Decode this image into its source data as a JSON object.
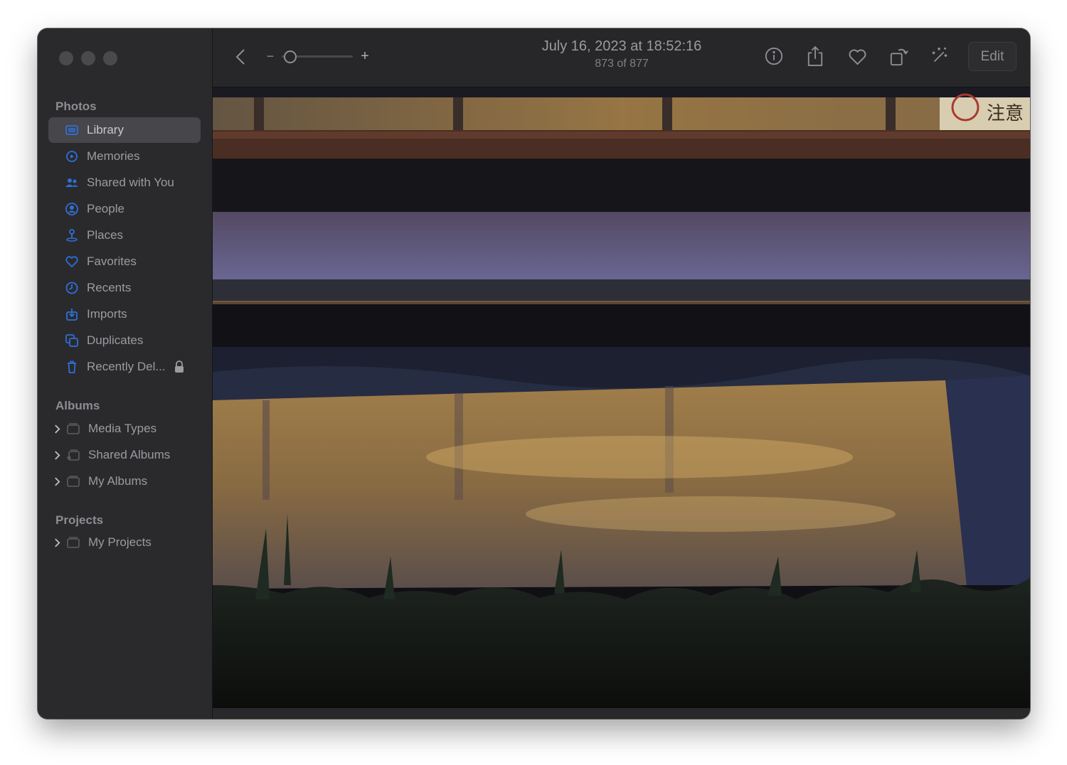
{
  "sidebar": {
    "sections": {
      "photos": "Photos",
      "albums": "Albums",
      "projects": "Projects"
    },
    "items": [
      {
        "label": "Library",
        "icon": "library-icon"
      },
      {
        "label": "Memories",
        "icon": "memories-icon"
      },
      {
        "label": "Shared with You",
        "icon": "shared-with-you-icon"
      },
      {
        "label": "People",
        "icon": "people-icon"
      },
      {
        "label": "Places",
        "icon": "places-icon"
      },
      {
        "label": "Favorites",
        "icon": "heart-icon"
      },
      {
        "label": "Recents",
        "icon": "clock-icon"
      },
      {
        "label": "Imports",
        "icon": "import-icon"
      },
      {
        "label": "Duplicates",
        "icon": "duplicates-icon"
      },
      {
        "label": "Recently Del...",
        "icon": "trash-icon"
      }
    ],
    "albums": [
      {
        "label": "Media Types",
        "icon": "folder-icon"
      },
      {
        "label": "Shared Albums",
        "icon": "shared-folder-icon"
      },
      {
        "label": "My Albums",
        "icon": "folder-icon"
      }
    ],
    "projects": [
      {
        "label": "My Projects",
        "icon": "folder-icon"
      }
    ]
  },
  "toolbar": {
    "title": "July 16, 2023 at 18:52:16",
    "subtitle": "873 of 877",
    "zoom_minus": "−",
    "zoom_plus": "+",
    "edit_label": "Edit"
  },
  "colors": {
    "sidebar_bg": "#2a2a2d",
    "toolbar_bg": "#27272a",
    "selected_bg": "#46464b",
    "icon_accent": "#2f6fd6"
  },
  "photo": {
    "description": ""
  }
}
